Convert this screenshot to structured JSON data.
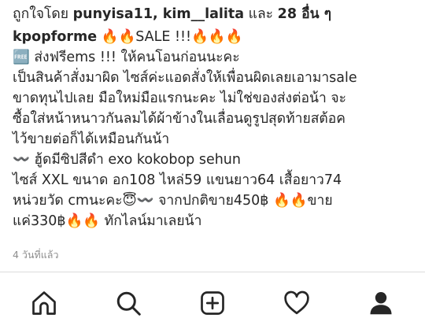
{
  "post": {
    "liked_by_prefix": "ถูกใจโดย ",
    "liked_by_users": "punyisa11, kim__lalita",
    "liked_by_middle": " และ ",
    "liked_by_count": "28 อื่น ๆ",
    "caption_username": "kpopforme",
    "caption_lines": [
      "🔥🔥SALE !!!🔥🔥🔥",
      "🆓 ส่งฟรีems !!! ให้คนโอนก่อนนะคะ",
      "เป็นสินค้าสั่งมาผิด ไซส์ค่ะแอดสั่งให้เพื่อนผิดเลยเอามาsale",
      "ขาดทุนไปเลย มือใหม่มือแรกนะคะ ไม่ใช่ของส่งต่อน้า  จะ",
      "ซื้อใส่หน้าหนาวกันลมได้ผ้าข้างในเลื่อนดูรูปสุดท้ายสต้อค",
      "ไว้ขายต่อก็ได้เหมือนกันน้า",
      "〰️ ฮู้ดมีซิปสีดำ exo kokobop sehun",
      "ไซส์ XXL ขนาด อก108 ไหล่59 แขนยาว64 เสื้อยาว74",
      "หน่วยวัด cmนะคะ😇〰️ จากปกติขาย450฿ 🔥🔥ขาย",
      "แค่330฿🔥🔥 ทักไลน์มาเลยน้า"
    ],
    "timestamp": "4 วันที่แล้ว"
  },
  "nav": {
    "items": [
      {
        "name": "home-icon"
      },
      {
        "name": "search-icon"
      },
      {
        "name": "add-post-icon"
      },
      {
        "name": "heart-icon"
      },
      {
        "name": "profile-icon"
      }
    ]
  }
}
